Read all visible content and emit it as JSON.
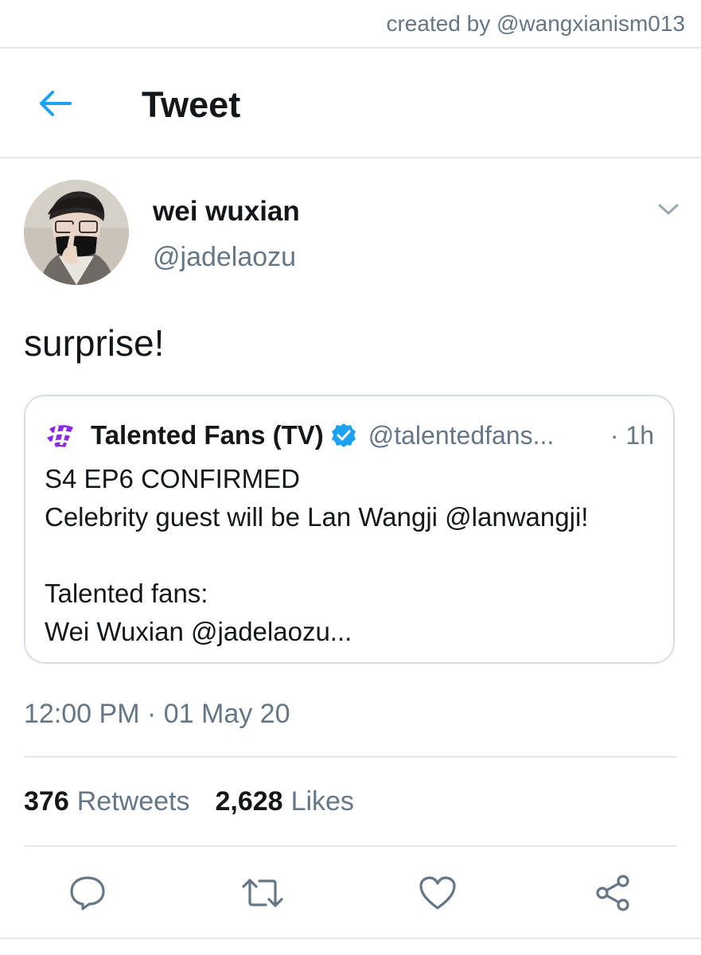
{
  "credit": "created by @wangxianism013",
  "header": {
    "title": "Tweet"
  },
  "tweet": {
    "display_name": "wei wuxian",
    "handle": "@jadelaozu",
    "text": "surprise!",
    "timestamp": "12:00 PM · 01 May 20"
  },
  "quote": {
    "display_name": "Talented Fans (TV)",
    "handle": "@talentedfans...",
    "time": "· 1h",
    "lines": [
      "S4 EP6 CONFIRMED",
      "Celebrity guest will be Lan Wangji @lanwangji!",
      "",
      "Talented fans:",
      "Wei Wuxian @jadelaozu..."
    ],
    "logo_color": "#8a2be2"
  },
  "stats": {
    "retweets_count": "376",
    "retweets_label": "Retweets",
    "likes_count": "2,628",
    "likes_label": "Likes"
  },
  "icons": {
    "back": "arrow-left-icon",
    "caret": "chevron-down-icon",
    "verified": "verified-badge-icon",
    "reply": "reply-icon",
    "retweet": "retweet-icon",
    "like": "heart-icon",
    "share": "share-icon"
  },
  "colors": {
    "accent": "#1da1f2",
    "secondary_text": "#657786",
    "divider": "#e1e8ed"
  }
}
